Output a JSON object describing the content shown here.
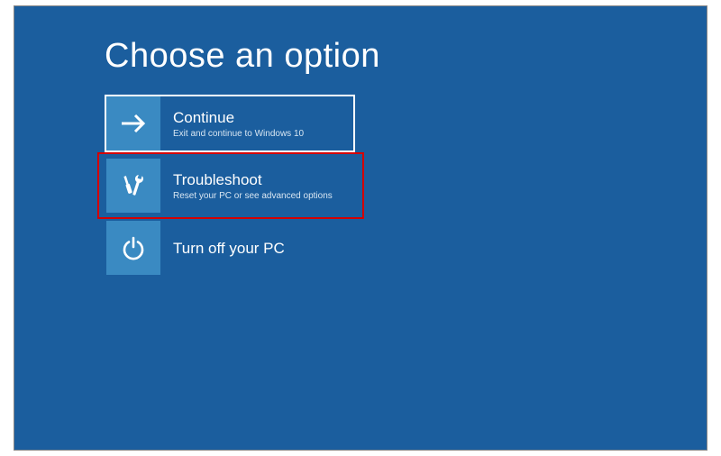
{
  "title": "Choose an option",
  "options": {
    "continue": {
      "label": "Continue",
      "desc": "Exit and continue to Windows 10"
    },
    "troubleshoot": {
      "label": "Troubleshoot",
      "desc": "Reset your PC or see advanced options"
    },
    "turnoff": {
      "label": "Turn off your PC"
    }
  },
  "colors": {
    "background": "#1b5e9e",
    "tile_icon_bg": "#3a8ac2",
    "highlight": "#d40000"
  }
}
